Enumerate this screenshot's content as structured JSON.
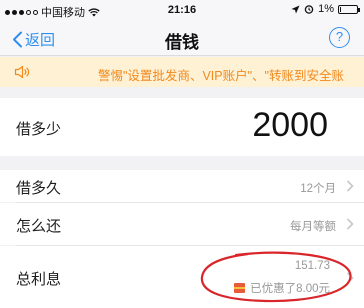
{
  "statusbar": {
    "carrier": "中国移动",
    "time": "21:16",
    "battery": "1%"
  },
  "nav": {
    "back_label": "返回",
    "title": "借钱",
    "help_label": "?"
  },
  "notice": {
    "text": "警惕\"设置批发商、VIP账户\"、\"转账到安全账"
  },
  "amount": {
    "label": "借多少",
    "value": "2000"
  },
  "term": {
    "label": "借多久",
    "value": "12个月"
  },
  "repay": {
    "label": "怎么还",
    "value": "每月等额"
  },
  "interest": {
    "label": "总利息",
    "value": "151.73",
    "discount": "已优惠了8.00元"
  },
  "colors": {
    "accent": "#2f8ff0",
    "notice_bg": "#fff1d4",
    "notice_text": "#f08a1e",
    "annotation": "#d8262a"
  },
  "icons": [
    "signal-icon",
    "wifi-icon",
    "location-icon",
    "alarm-icon",
    "battery-icon",
    "back-chevron-icon",
    "help-icon",
    "speaker-icon",
    "chevron-right-icon",
    "coupon-icon"
  ]
}
